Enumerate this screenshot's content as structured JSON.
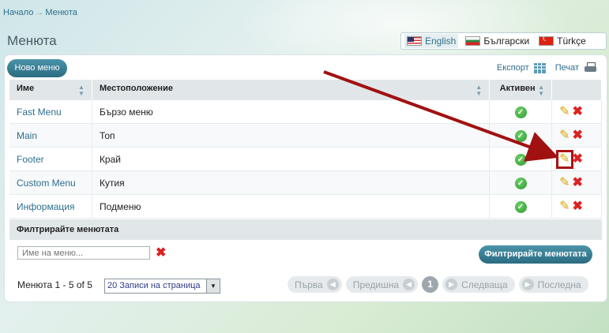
{
  "breadcrumb": {
    "home": "Начало",
    "separator": "→",
    "current": "Менюта"
  },
  "page_title": "Менюта",
  "languages": [
    {
      "label": "English",
      "flag": "flag-us-icon",
      "active": true
    },
    {
      "label": "Български",
      "flag": "flag-bg-icon",
      "active": false
    },
    {
      "label": "Türkçe",
      "flag": "flag-tr-icon",
      "active": false
    }
  ],
  "toolbar": {
    "new_menu": "Ново меню",
    "export": "Експорт",
    "print": "Печат"
  },
  "table": {
    "headers": {
      "name": "Име",
      "location": "Местоположение",
      "active": "Активен"
    },
    "rows": [
      {
        "name": "Fast Menu",
        "location": "Бързо меню",
        "active": true
      },
      {
        "name": "Main",
        "location": "Топ",
        "active": true
      },
      {
        "name": "Footer",
        "location": "Край",
        "active": true
      },
      {
        "name": "Custom Menu",
        "location": "Кутия",
        "active": true
      },
      {
        "name": "Информация",
        "location": "Подменю",
        "active": true
      }
    ]
  },
  "filter": {
    "title": "Филтрирайте менютата",
    "placeholder": "Име на меню...",
    "button": "Филтрирайте менютата"
  },
  "pager": {
    "info": "Менюта 1 - 5 of 5",
    "per_page": "20 Записи на страница",
    "first": "Първа",
    "prev": "Предишна",
    "page": "1",
    "next": "Следваща",
    "last": "Последна"
  },
  "colors": {
    "accent": "#2b6c82",
    "link": "#2e6f8e",
    "annotation": "#a11111"
  }
}
